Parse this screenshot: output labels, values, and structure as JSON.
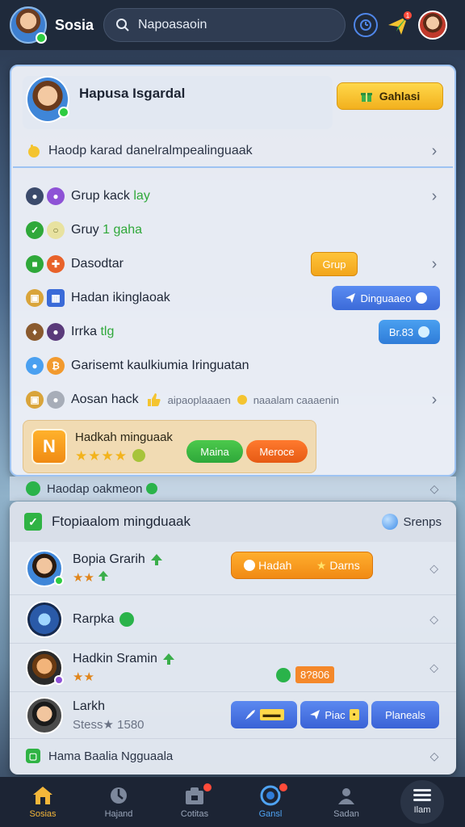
{
  "header": {
    "brand": "Sosia",
    "search_placeholder": "Napoasaoin",
    "notification_count": "1"
  },
  "profile": {
    "name": "Hapusa Isgardal",
    "action_label": "Gahlasi",
    "note": "Haodp karad danelralmpealinguaak"
  },
  "menu": {
    "items": [
      {
        "label": "Grup kack",
        "highlight": "lay"
      },
      {
        "label": "Gruy",
        "highlight": "1 gaha"
      },
      {
        "label": "Dasodtar",
        "button": "Grup"
      },
      {
        "label": "Hadan ikinglaoak",
        "button": "Dinguaaeo"
      },
      {
        "label": "Irrka",
        "highlight": "tlg",
        "button": "Br.83"
      },
      {
        "label": "Garisemt kaulkiumia Iringuatan"
      },
      {
        "label": "Aosan hack",
        "extra": "aipaoplaaaen",
        "extra2": "naaalam caaaenin"
      }
    ],
    "promo": {
      "title": "Hadkah minguaak",
      "stars": "★★★★",
      "btn_green": "Maina",
      "btn_orange": "Meroce"
    }
  },
  "strip": {
    "label": "Haodap oakmeon"
  },
  "panel2": {
    "title": "Ftopiaalom mingduaak",
    "link": "Srenps",
    "rows": [
      {
        "name": "Bopia Grarih",
        "stars": "★★",
        "btn_left": "Hadah",
        "btn_right": "Darns"
      },
      {
        "name": "Rarpka"
      },
      {
        "name": "Hadkin Sramin",
        "stars": "★★",
        "tag": "8?806"
      },
      {
        "name": "Larkh",
        "sub": "Stess★ 1580",
        "chips": [
          "",
          "Piac",
          "Planeals"
        ]
      }
    ],
    "footer": "Hama Baalia Ngguaala"
  },
  "nav": {
    "items": [
      {
        "label": "Sosias"
      },
      {
        "label": "Hajand"
      },
      {
        "label": "Cotitas"
      },
      {
        "label": "Gansl"
      },
      {
        "label": "Sadan"
      },
      {
        "label": "Ilam"
      }
    ]
  },
  "colors": {
    "accent_blue": "#3b6ad8",
    "accent_orange": "#f18a14",
    "accent_yellow": "#f2b01e",
    "accent_green": "#2ea83a",
    "topbar_bg": "#1f2a3b"
  }
}
